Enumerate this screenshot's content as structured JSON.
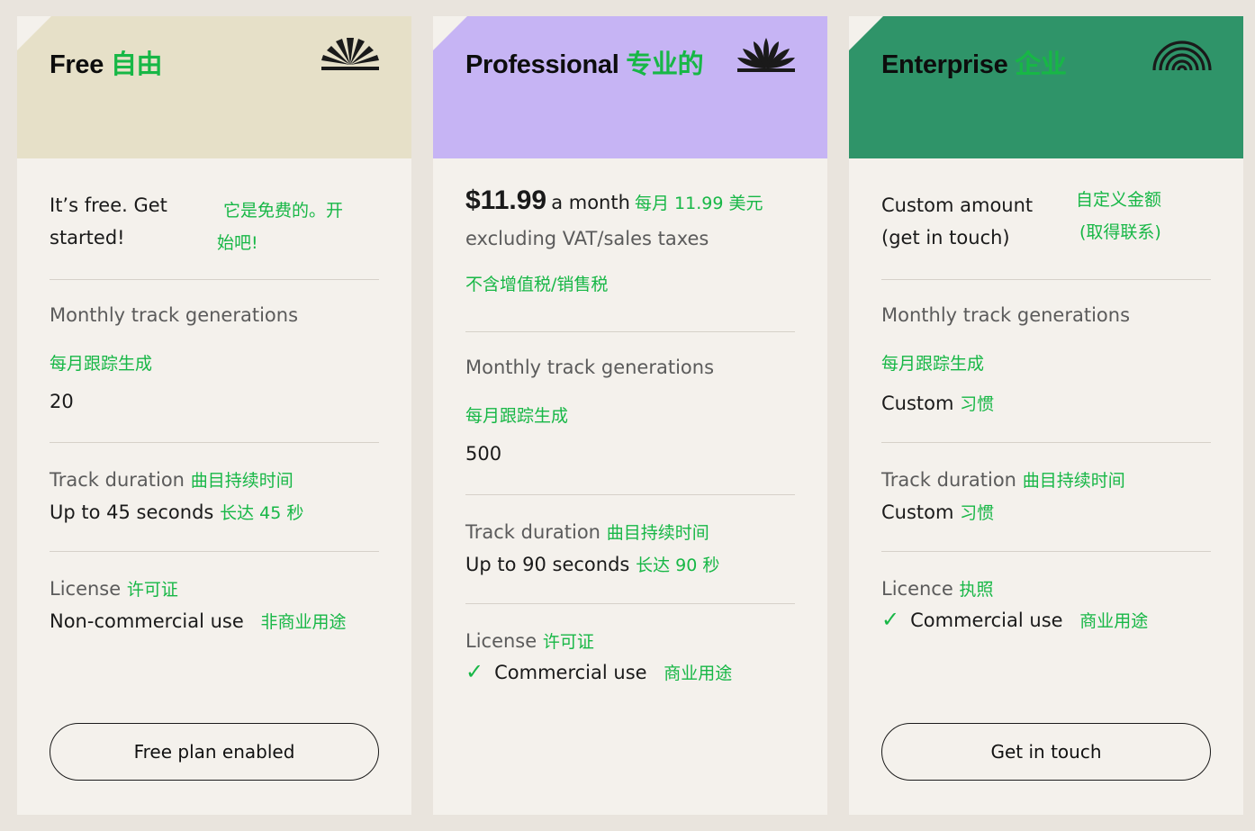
{
  "colors": {
    "free_header": "#e6e0c8",
    "pro_header": "#c6b4f4",
    "enterprise_header": "#2f9469",
    "accent_green": "#17b746"
  },
  "free": {
    "name": "Free",
    "name_cn": "自由",
    "intro_line1": "It’s free. Get",
    "intro_line2": "started!",
    "intro_cn_line1": "它是免费的。开",
    "intro_cn_line2": "始吧!",
    "generations_label": "Monthly track generations",
    "generations_label_cn": "每月跟踪生成",
    "generations_value": "20",
    "duration_label": "Track duration",
    "duration_label_cn": "曲目持续时间",
    "duration_value": "Up to 45 seconds",
    "duration_value_cn": "长达 45 秒",
    "license_label": "License",
    "license_label_cn": "许可证",
    "license_value": "Non-commercial use",
    "license_value_cn": "非商业用途",
    "button": "Free plan enabled"
  },
  "pro": {
    "name": "Professional",
    "name_cn": "专业的",
    "price": "$11.99",
    "price_period": "a month",
    "price_cn": "每月 11.99 美元",
    "price_note": "excluding VAT/sales taxes",
    "price_note_cn": "不含增值税/销售税",
    "generations_label": "Monthly track generations",
    "generations_label_cn": "每月跟踪生成",
    "generations_value": "500",
    "duration_label": "Track duration",
    "duration_label_cn": "曲目持续时间",
    "duration_value": "Up to 90 seconds",
    "duration_value_cn": "长达 90 秒",
    "license_label": "License",
    "license_label_cn": "许可证",
    "license_value": "Commercial use",
    "license_value_cn": "商业用途"
  },
  "enterprise": {
    "name": "Enterprise",
    "name_cn": "企业",
    "intro_line1": "Custom amount",
    "intro_line2": "(get in touch)",
    "intro_cn_line1": "自定义金额",
    "intro_cn_line2": "(取得联系)",
    "generations_label": "Monthly track generations",
    "generations_label_cn": "每月跟踪生成",
    "generations_value": "Custom",
    "generations_value_cn": "习惯",
    "duration_label": "Track duration",
    "duration_label_cn": "曲目持续时间",
    "duration_value": "Custom",
    "duration_value_cn": "习惯",
    "license_label": "Licence",
    "license_label_cn": "执照",
    "license_value": "Commercial use",
    "license_value_cn": "商业用途",
    "button": "Get in touch"
  }
}
